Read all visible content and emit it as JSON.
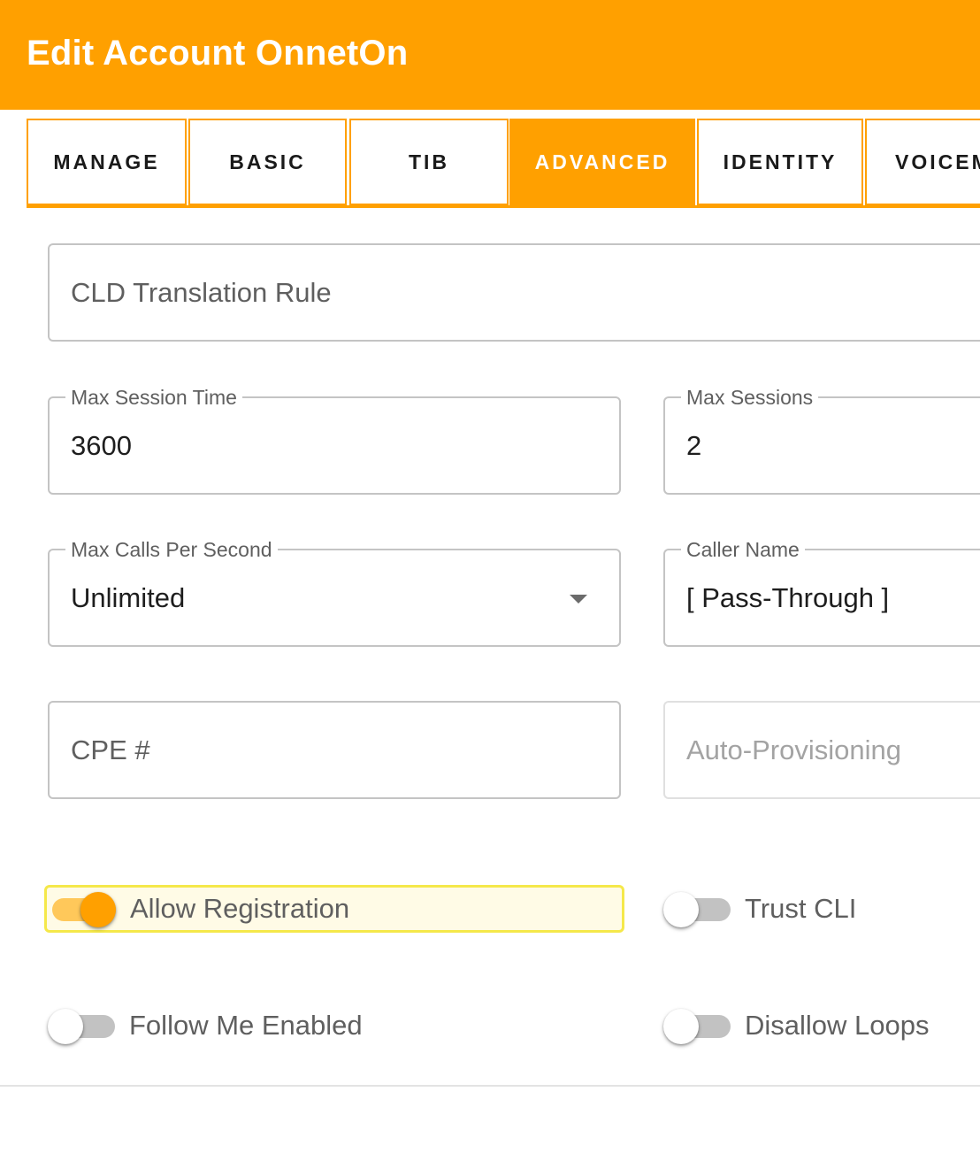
{
  "header": {
    "title": "Edit Account OnnetOn",
    "color": "#ffa000"
  },
  "tabs": [
    {
      "label": "MANAGE",
      "active": false
    },
    {
      "label": "BASIC",
      "active": false
    },
    {
      "label": "TIB",
      "active": false
    },
    {
      "label": "ADVANCED",
      "active": true
    },
    {
      "label": "IDENTITY",
      "active": false
    },
    {
      "label": "VOICEM",
      "active": false
    }
  ],
  "form": {
    "cld_translation_rule": {
      "placeholder": "CLD Translation Rule",
      "value": ""
    },
    "max_session_time": {
      "label": "Max Session Time",
      "value": "3600"
    },
    "max_sessions": {
      "label": "Max Sessions",
      "value": "2"
    },
    "max_calls_per_second": {
      "label": "Max Calls Per Second",
      "value": "Unlimited",
      "icon": "dropdown-arrow-icon"
    },
    "caller_name": {
      "label": "Caller Name",
      "value": "[ Pass-Through ]"
    },
    "cpe_number": {
      "placeholder": "CPE #",
      "value": ""
    },
    "auto_provisioning": {
      "placeholder": "Auto-Provisioning",
      "value": "",
      "disabled": true
    }
  },
  "toggles": {
    "allow_registration": {
      "label": "Allow Registration",
      "checked": true
    },
    "trust_cli": {
      "label": "Trust CLI",
      "checked": false
    },
    "follow_me_enabled": {
      "label": "Follow Me Enabled",
      "checked": false
    },
    "disallow_loops": {
      "label": "Disallow Loops",
      "checked": false
    }
  }
}
